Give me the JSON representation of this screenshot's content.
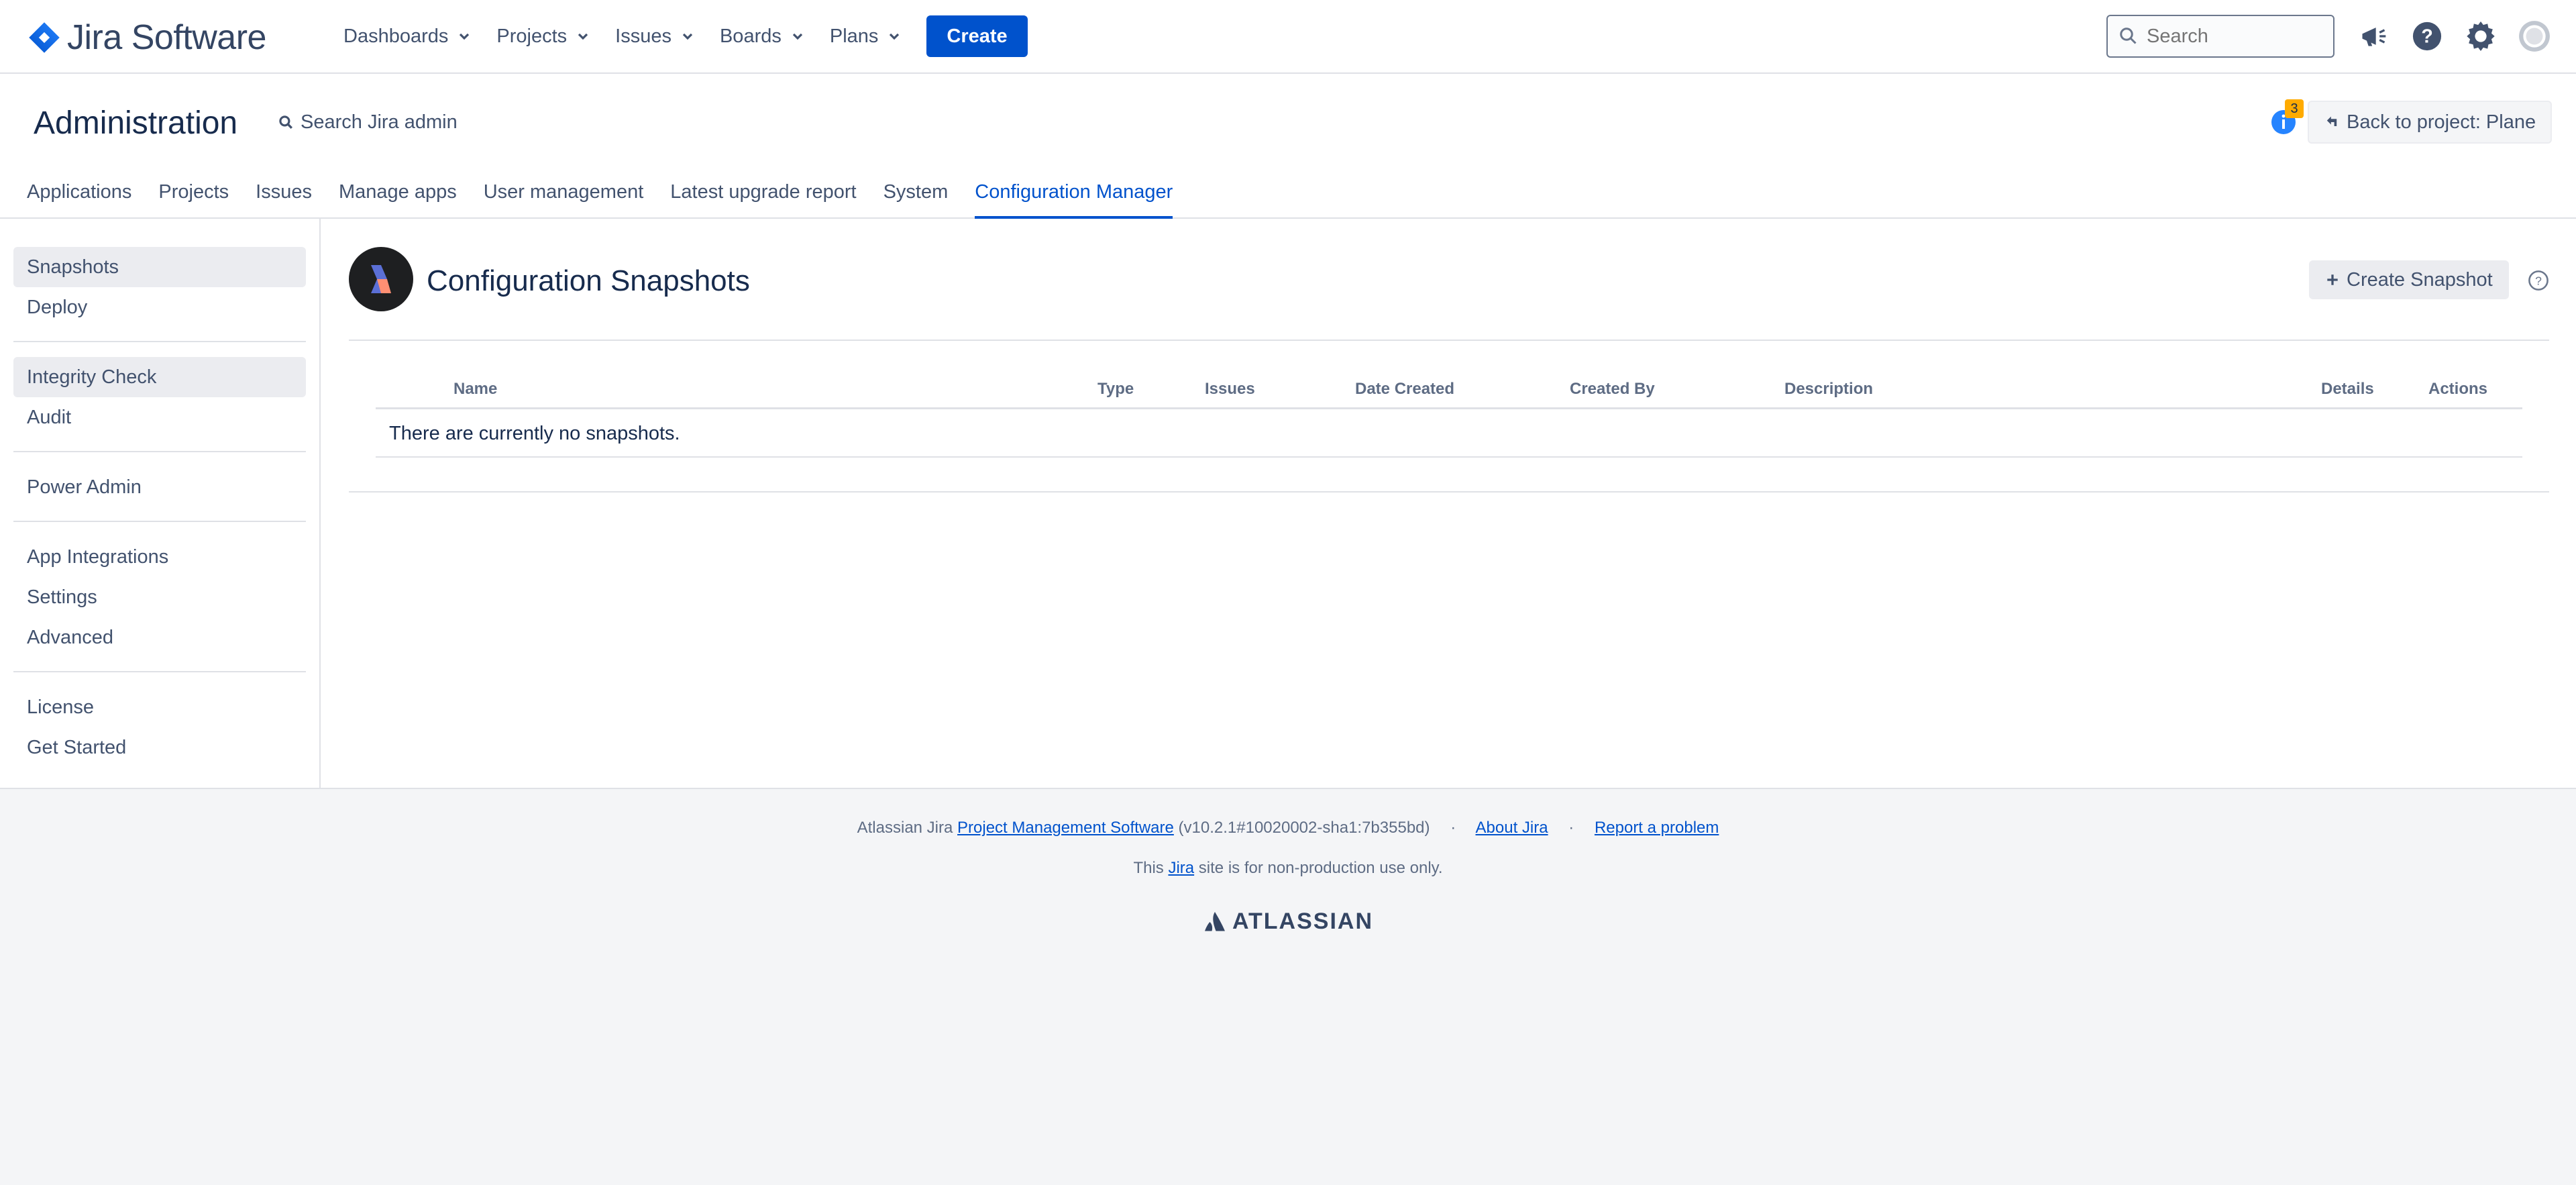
{
  "topnav": {
    "brand": "Jira Software",
    "menu": [
      {
        "label": "Dashboards"
      },
      {
        "label": "Projects"
      },
      {
        "label": "Issues"
      },
      {
        "label": "Boards"
      },
      {
        "label": "Plans"
      }
    ],
    "create_label": "Create",
    "search_placeholder": "Search",
    "icons": [
      "notifications-icon",
      "help-icon",
      "settings-icon",
      "profile-avatar-icon"
    ]
  },
  "admin": {
    "title": "Administration",
    "search_label": "Search Jira admin",
    "notification_count": "3",
    "back_label": "Back to project: Plane",
    "tabs": [
      {
        "label": "Applications"
      },
      {
        "label": "Projects"
      },
      {
        "label": "Issues"
      },
      {
        "label": "Manage apps"
      },
      {
        "label": "User management"
      },
      {
        "label": "Latest upgrade report"
      },
      {
        "label": "System"
      },
      {
        "label": "Configuration Manager"
      }
    ],
    "active_tab": "Configuration Manager"
  },
  "sidebar": {
    "groups": [
      [
        {
          "label": "Snapshots"
        },
        {
          "label": "Deploy"
        }
      ],
      [
        {
          "label": "Integrity Check"
        },
        {
          "label": "Audit"
        }
      ],
      [
        {
          "label": "Power Admin"
        }
      ],
      [
        {
          "label": "App Integrations"
        },
        {
          "label": "Settings"
        },
        {
          "label": "Advanced"
        }
      ],
      [
        {
          "label": "License"
        },
        {
          "label": "Get Started"
        }
      ]
    ],
    "selected": [
      "Snapshots",
      "Integrity Check"
    ]
  },
  "main": {
    "title": "Configuration Snapshots",
    "create_snapshot_label": "Create Snapshot",
    "table": {
      "columns": [
        "Name",
        "Type",
        "Issues",
        "Date Created",
        "Created By",
        "Description",
        "Details",
        "Actions"
      ],
      "empty_message": "There are currently no snapshots."
    }
  },
  "footer": {
    "prefix": "Atlassian Jira",
    "pm_link": "Project Management Software",
    "version": "(v10.2.1#10020002-sha1:7b355bd)",
    "about_link": "About Jira",
    "report_link": "Report a problem",
    "line2_before": "This",
    "line2_link": "Jira",
    "line2_after": "site is for non-production use only.",
    "brand": "ATLASSIAN",
    "separator": "·"
  },
  "colors": {
    "primary": "#0052cc",
    "text": "#172b4d",
    "subtle": "#42526e",
    "badge": "#ffab00"
  }
}
